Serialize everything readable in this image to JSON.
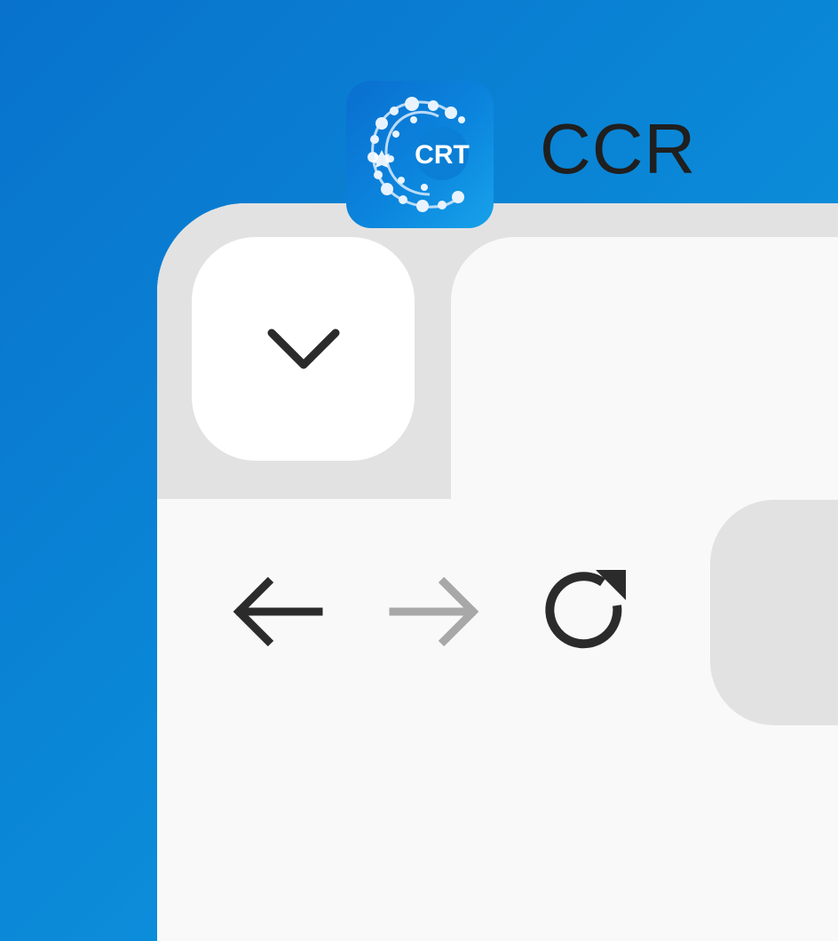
{
  "tab": {
    "title": "CCR",
    "favicon_text": "CRT",
    "favicon_icon": "crt-logo-icon"
  },
  "tab_strip": {
    "dropdown_icon": "chevron-down-icon"
  },
  "toolbar": {
    "back_icon": "arrow-left-icon",
    "forward_icon": "arrow-right-icon",
    "forward_enabled": false,
    "reload_icon": "reload-icon"
  },
  "colors": {
    "background_gradient_start": "#0872cc",
    "background_gradient_end": "#159fe6",
    "chrome_grey": "#e2e2e2",
    "toolbar_white": "#f9f9f9",
    "icon_dark": "#2b2b2b",
    "icon_disabled": "#a8a8a8"
  }
}
